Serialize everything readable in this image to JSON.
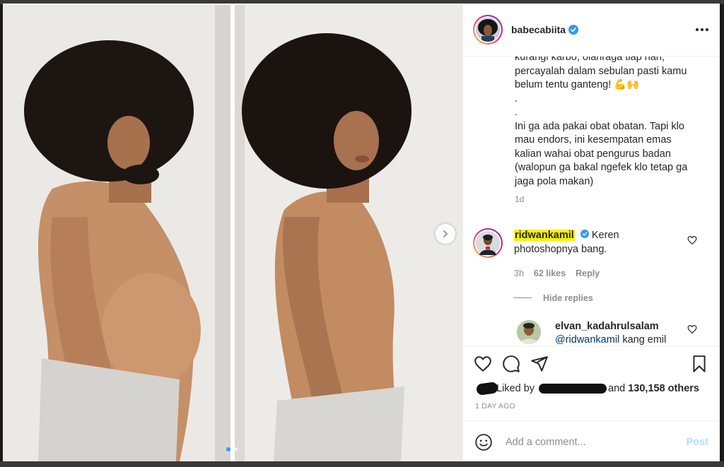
{
  "account": {
    "username": "babecabiita",
    "verified": true
  },
  "caption": {
    "lines": [
      "kurangi karbo, olahraga tiap hari,",
      "percayalah dalam sebulan pasti kamu",
      "belum tentu ganteng! 💪🙌",
      ".",
      ".",
      "Ini ga ada pakai obat obatan. Tapi klo",
      "mau endors, ini kesempatan emas",
      "kalian wahai obat pengurus badan",
      "(walopun ga bakal ngefek klo tetap ga",
      "jaga pola makan)"
    ],
    "time": "1d"
  },
  "comment": {
    "username": "ridwankamil",
    "verified": true,
    "text_first": "Keren",
    "text_second": "photoshopnya bang.",
    "time": "3h",
    "likes": "62 likes",
    "reply_label": "Reply"
  },
  "hide_replies_label": "Hide replies",
  "reply": {
    "username": "elvan_kadahrulsalam",
    "mention": "@ridwankamil",
    "text": "kang emil"
  },
  "likes": {
    "prefix": "Liked by",
    "connector": "and",
    "count": "130,158 others"
  },
  "post_date": "1 DAY AGO",
  "add_comment": {
    "placeholder": "Add a comment...",
    "post_label": "Post"
  },
  "colors": {
    "highlight": "#f7f200",
    "verified": "#3897f0",
    "post_disabled": "#b2dffc",
    "mention": "#00376b"
  },
  "carousel": {
    "total": 2,
    "current": 1
  }
}
